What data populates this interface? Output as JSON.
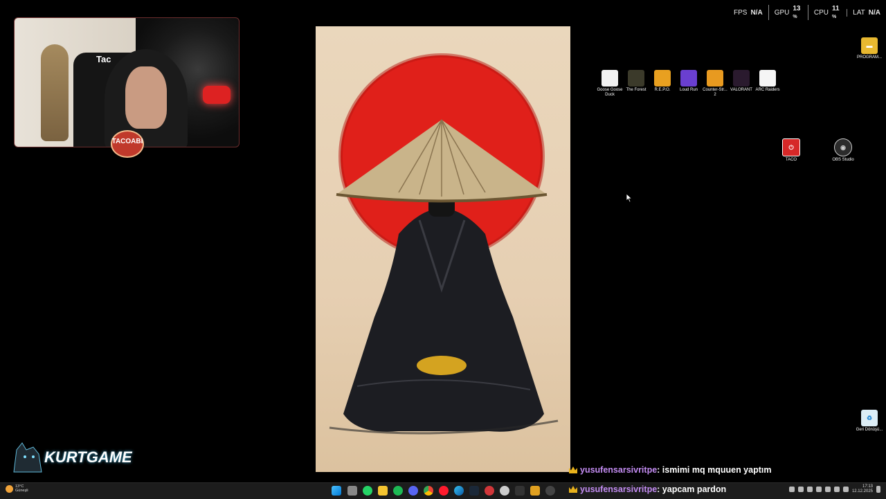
{
  "perf_overlay": {
    "fps_label": "FPS",
    "fps_value": "N/A",
    "gpu_label": "GPU",
    "gpu_value": "13",
    "cpu_label": "CPU",
    "cpu_value": "11",
    "lat_label": "LAT",
    "lat_value": "N/A",
    "percent": "%"
  },
  "webcam": {
    "chair_text": "Tac",
    "name_badge": "TACOABI"
  },
  "desktop_icons": [
    {
      "label": "Goose Goose Duck",
      "icon": "goose-icon",
      "color": "#f2f2f2"
    },
    {
      "label": "The Forest",
      "icon": "forest-icon",
      "color": "#3b3a2a"
    },
    {
      "label": "R.E.P.O.",
      "icon": "repo-icon",
      "color": "#e8a020"
    },
    {
      "label": "Loud Run",
      "icon": "loudrun-icon",
      "color": "#6a3fd0"
    },
    {
      "label": "Counter-Str... 2",
      "icon": "cs2-icon",
      "color": "#e89a20"
    },
    {
      "label": "VALORANT",
      "icon": "valorant-icon",
      "color": "#2a1a2e"
    },
    {
      "label": "ARC Raiders",
      "icon": "arc-raiders-icon",
      "color": "#f5f5f5"
    }
  ],
  "side_icons": {
    "program": {
      "label": "PROGRAM..."
    },
    "taco": {
      "label": "TACO"
    },
    "obs": {
      "label": "OBS Studio"
    },
    "recycle": {
      "label": "Geri Dönüşü..."
    }
  },
  "overlay_logo": {
    "text": "KURTGAME"
  },
  "chat": [
    {
      "user": "yusufensarsivritpe",
      "message": ": ismimi mq mquuen yaptım"
    },
    {
      "user": "yusufensarsivritpe",
      "message": ": yapcam pardon"
    }
  ],
  "taskbar": {
    "weather_temp": "13°C",
    "weather_desc": "Güneşli",
    "clock_time": "17:13",
    "clock_date": "12.12.2025"
  },
  "colors": {
    "accent_red": "#e0201a",
    "chat_user": "#c38cf2",
    "crown": "#e8b21c"
  }
}
